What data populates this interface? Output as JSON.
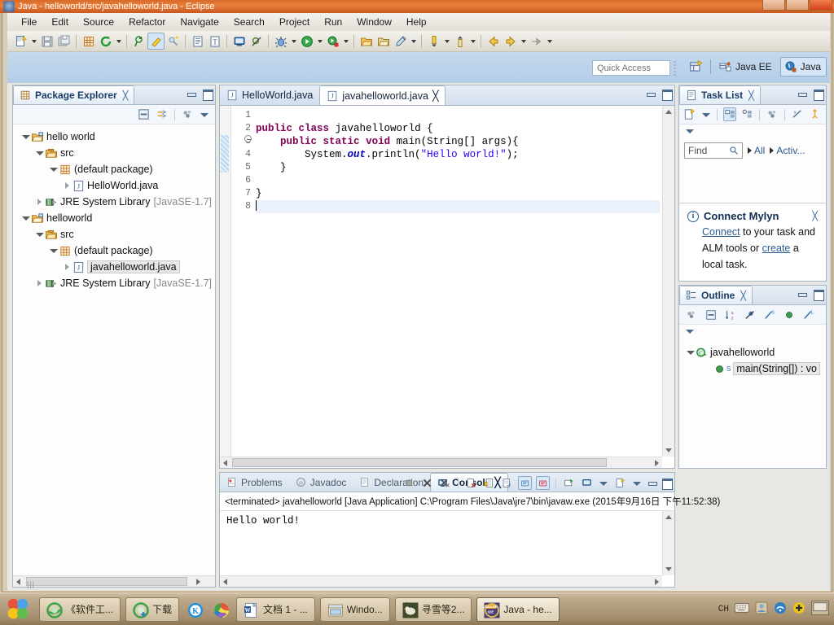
{
  "window": {
    "title": "Java - helloworld/src/javahelloworld.java - Eclipse",
    "app_icon": "eclipse-icon",
    "controls": [
      "minimize-button",
      "maximize-button",
      "close-button"
    ]
  },
  "menubar": {
    "items": [
      {
        "label": "File",
        "name": "menu-file"
      },
      {
        "label": "Edit",
        "name": "menu-edit"
      },
      {
        "label": "Source",
        "name": "menu-source"
      },
      {
        "label": "Refactor",
        "name": "menu-refactor"
      },
      {
        "label": "Navigate",
        "name": "menu-navigate"
      },
      {
        "label": "Search",
        "name": "menu-search"
      },
      {
        "label": "Project",
        "name": "menu-project"
      },
      {
        "label": "Run",
        "name": "menu-run"
      },
      {
        "label": "Window",
        "name": "menu-window"
      },
      {
        "label": "Help",
        "name": "menu-help"
      }
    ]
  },
  "toolbar": {
    "buttons": [
      {
        "name": "new-wizard-icon",
        "tip": "New"
      },
      {
        "name": "save-icon",
        "tip": "Save"
      },
      {
        "name": "save-all-icon",
        "tip": "Save All"
      },
      {
        "name": "new-package-icon",
        "tip": "New Java Package"
      },
      {
        "name": "refresh-icon",
        "tip": "Refresh"
      },
      {
        "name": "search-pin-icon",
        "tip": "Search"
      },
      {
        "name": "build-icon",
        "tip": "Build"
      },
      {
        "name": "quick-fix-icon",
        "tip": "Quick Fix"
      },
      {
        "name": "open-type-icon",
        "tip": "Open Type"
      },
      {
        "name": "open-task-icon",
        "tip": "Open Task"
      },
      {
        "name": "terminal-icon",
        "tip": "Console"
      },
      {
        "name": "skip-breakpoints-icon",
        "tip": "Skip All Breakpoints"
      },
      {
        "name": "debug-icon",
        "tip": "Debug"
      },
      {
        "name": "run-icon",
        "tip": "Run"
      },
      {
        "name": "external-tools-icon",
        "tip": "External Tools"
      },
      {
        "name": "open-folder-icon",
        "tip": "Open Resource"
      },
      {
        "name": "open-folder-2-icon",
        "tip": "Open"
      },
      {
        "name": "pencil-edit-icon",
        "tip": "Edit"
      },
      {
        "name": "next-annotation-icon",
        "tip": "Next Annotation"
      },
      {
        "name": "previous-annotation-icon",
        "tip": "Previous Annotation"
      },
      {
        "name": "back-icon",
        "tip": "Back"
      },
      {
        "name": "forward-icon",
        "tip": "Forward"
      },
      {
        "name": "next-edit-icon",
        "tip": "Next Edit Location"
      }
    ]
  },
  "quick_access": {
    "placeholder": "Quick Access",
    "value": ""
  },
  "perspectives": {
    "open_perspective_tip": "Open Perspective",
    "items": [
      {
        "label": "Java EE",
        "name": "perspective-java-ee",
        "active": false
      },
      {
        "label": "Java",
        "name": "perspective-java",
        "active": true
      }
    ]
  },
  "package_explorer": {
    "title": "Package Explorer",
    "close_glyph": "╳",
    "toolbar": [
      {
        "name": "collapse-all-icon"
      },
      {
        "name": "link-with-editor-icon"
      },
      {
        "name": "view-menu-filter-icon"
      },
      {
        "name": "view-menu-icon"
      }
    ],
    "tree": [
      {
        "label": "hello world",
        "indent": 0,
        "twist": "open",
        "icon": "project-folder-icon",
        "selected": false,
        "dim": ""
      },
      {
        "label": "src",
        "indent": 1,
        "twist": "open",
        "icon": "source-folder-icon",
        "selected": false,
        "dim": ""
      },
      {
        "label": "(default package)",
        "indent": 2,
        "twist": "open",
        "icon": "package-icon",
        "selected": false,
        "dim": ""
      },
      {
        "label": "HelloWorld.java",
        "indent": 3,
        "twist": "closed",
        "icon": "java-file-icon",
        "selected": false,
        "dim": ""
      },
      {
        "label": "JRE System Library",
        "indent": 1,
        "twist": "closed",
        "icon": "library-icon",
        "selected": false,
        "dim": "[JavaSE-1.7]"
      },
      {
        "label": "helloworld",
        "indent": 0,
        "twist": "open",
        "icon": "project-folder-icon",
        "selected": false,
        "dim": ""
      },
      {
        "label": "src",
        "indent": 1,
        "twist": "open",
        "icon": "source-folder-icon",
        "selected": false,
        "dim": ""
      },
      {
        "label": "(default package)",
        "indent": 2,
        "twist": "open",
        "icon": "package-icon",
        "selected": false,
        "dim": ""
      },
      {
        "label": "javahelloworld.java",
        "indent": 3,
        "twist": "closed",
        "icon": "java-file-icon",
        "selected": true,
        "dim": ""
      },
      {
        "label": "JRE System Library",
        "indent": 1,
        "twist": "closed",
        "icon": "library-icon",
        "selected": false,
        "dim": "[JavaSE-1.7]"
      }
    ]
  },
  "editor": {
    "tabs": [
      {
        "label": "HelloWorld.java",
        "name": "editor-tab-helloworld",
        "selected": false,
        "closable": false
      },
      {
        "label": "javahelloworld.java",
        "name": "editor-tab-javahelloworld",
        "selected": true,
        "closable": true
      }
    ],
    "close_glyph": "╳",
    "gutter": [
      "1",
      "2",
      "3",
      "4",
      "5",
      "6",
      "7",
      "8"
    ],
    "code_lines": [
      {
        "n": 1,
        "text": "",
        "current": false
      },
      {
        "n": 2,
        "text": "public class javahelloworld {",
        "current": false
      },
      {
        "n": 3,
        "text": "    public static void main(String[] args){",
        "current": false
      },
      {
        "n": 4,
        "text": "        System.out.println(\"Hello world!\");",
        "current": false
      },
      {
        "n": 5,
        "text": "    }",
        "current": false
      },
      {
        "n": 6,
        "text": "",
        "current": false
      },
      {
        "n": 7,
        "text": "}",
        "current": false
      },
      {
        "n": 8,
        "text": "",
        "current": true
      }
    ]
  },
  "task_list": {
    "title": "Task List",
    "close_glyph": "╳",
    "toolbar": [
      {
        "name": "new-task-icon"
      },
      {
        "name": "categorized-presentation-icon"
      },
      {
        "name": "scheduled-presentation-icon"
      },
      {
        "name": "focus-on-workweek-icon"
      },
      {
        "name": "synchronize-changed-icon"
      },
      {
        "name": "activate-task-icon"
      },
      {
        "name": "view-menu-icon"
      }
    ],
    "find": {
      "placeholder": "Find",
      "value": "",
      "icon": "search-icon"
    },
    "filters": [
      {
        "label": "All",
        "name": "task-filter-all"
      },
      {
        "label": "Activ...",
        "name": "task-filter-activate"
      }
    ],
    "notice": {
      "icon": "info-icon",
      "glyph": "i",
      "title": "Connect Mylyn",
      "link1": "Connect",
      "text1": " to your task and",
      "text2": "ALM tools or ",
      "link2": "create",
      "text3": " a",
      "text4": "local task.",
      "close_glyph": "╳"
    }
  },
  "outline": {
    "title": "Outline",
    "close_glyph": "╳",
    "toolbar": [
      {
        "name": "focus-on-active-task-icon"
      },
      {
        "name": "collapse-all-icon"
      },
      {
        "name": "sort-alphabetically-icon"
      },
      {
        "name": "hide-fields-icon"
      },
      {
        "name": "hide-static-icon"
      },
      {
        "name": "hide-nonpublic-icon"
      },
      {
        "name": "hide-local-types-icon"
      },
      {
        "name": "view-menu-icon"
      }
    ],
    "items": [
      {
        "label": "javahelloworld",
        "indent": 0,
        "twist": "open",
        "icon": "class-icon",
        "selected": false
      },
      {
        "label": "main(String[]) : vo",
        "indent": 1,
        "twist": "none",
        "icon": "public-method-icon",
        "selected": true,
        "badge": "S"
      }
    ]
  },
  "bottom_panel": {
    "tabs": [
      {
        "label": "Problems",
        "name": "tab-problems",
        "icon": "problems-icon",
        "selected": false
      },
      {
        "label": "Javadoc",
        "name": "tab-javadoc",
        "icon": "javadoc-icon",
        "selected": false
      },
      {
        "label": "Declaration",
        "name": "tab-declaration",
        "icon": "declaration-icon",
        "selected": false
      },
      {
        "label": "Console",
        "name": "tab-console",
        "icon": "console-icon",
        "selected": true
      }
    ],
    "close_glyph": "╳",
    "toolbar": [
      {
        "name": "terminate-icon"
      },
      {
        "name": "remove-launch-icon"
      },
      {
        "name": "remove-all-terminated-icon"
      },
      {
        "name": "clear-console-icon"
      },
      {
        "name": "scroll-lock-icon"
      },
      {
        "name": "word-wrap-icon"
      },
      {
        "name": "show-console-on-output-icon"
      },
      {
        "name": "show-console-on-error-icon"
      },
      {
        "name": "pin-console-icon"
      },
      {
        "name": "display-selected-console-icon"
      },
      {
        "name": "open-console-icon"
      }
    ],
    "console": {
      "header": "<terminated> javahelloworld [Java Application] C:\\Program Files\\Java\\jre7\\bin\\javaw.exe (2015年9月16日 下午11:52:38)",
      "output": "Hello world!"
    }
  },
  "taskbar": {
    "start_name": "start-orb-button",
    "items": [
      {
        "label": "《软件工...",
        "name": "taskbar-item-software-doc",
        "icon": "ie-icon",
        "active": false
      },
      {
        "label": "下载",
        "name": "taskbar-item-download",
        "icon": "ie-download-icon",
        "active": false
      },
      {
        "label": "",
        "name": "taskbar-item-kingsoft",
        "icon": "kingsoft-icon",
        "active": false,
        "iconOnly": true
      },
      {
        "label": "",
        "name": "taskbar-item-browser",
        "icon": "colorful-browser-icon",
        "active": false,
        "iconOnly": true
      },
      {
        "label": "文档 1 - ...",
        "name": "taskbar-item-word-doc",
        "icon": "word-icon",
        "active": false
      },
      {
        "label": "Windo...",
        "name": "taskbar-item-explorer",
        "icon": "explorer-folder-icon",
        "active": false
      },
      {
        "label": "寻雪等2...",
        "name": "taskbar-item-chat",
        "icon": "bird-photo-icon",
        "active": false
      },
      {
        "label": "Java - he...",
        "name": "taskbar-item-eclipse",
        "icon": "eclipse-ide-icon",
        "active": true
      }
    ],
    "tray": [
      {
        "name": "ime-indicator",
        "label": "CH"
      },
      {
        "name": "keyboard-icon",
        "label": ""
      },
      {
        "name": "tray-app-1-icon",
        "label": ""
      },
      {
        "name": "tray-network-icon",
        "label": ""
      },
      {
        "name": "tray-update-icon",
        "label": ""
      },
      {
        "name": "show-desktop-button",
        "label": ""
      }
    ]
  },
  "colors": {
    "keyword": "#7f0055",
    "string": "#2a00ff",
    "field": "#0000c0",
    "accent": "#2a5a8c",
    "title_bar": "#d96a2a"
  }
}
